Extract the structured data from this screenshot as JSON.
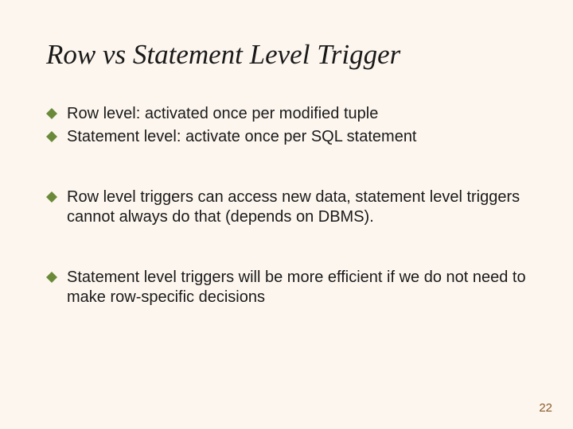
{
  "title": "Row vs Statement Level Trigger",
  "bullets": [
    {
      "text": "Row level:  activated once per modified tuple",
      "gap": false
    },
    {
      "text": "Statement level: activate once per SQL statement",
      "gap": false
    },
    {
      "text": "Row level triggers can access new data, statement level triggers cannot always do that (depends on DBMS).",
      "gap": true
    },
    {
      "text": "Statement level triggers will be more efficient if we do not need to make row-specific decisions",
      "gap": true
    }
  ],
  "page_number": "22",
  "bullet_color": "#6a8a3a"
}
